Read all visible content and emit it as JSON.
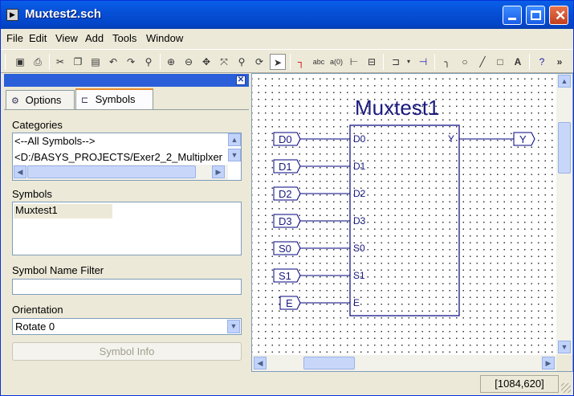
{
  "window": {
    "title": "Muxtest2.sch",
    "app_icon": "schematic-app-icon",
    "controls": [
      "minimize",
      "maximize",
      "close"
    ]
  },
  "menubar": {
    "items": [
      "File",
      "Edit",
      "View",
      "Add",
      "Tools",
      "Window"
    ]
  },
  "toolbar": {
    "icons": [
      "save-icon",
      "print-icon",
      "cut-icon",
      "copy-icon",
      "paste-icon",
      "undo-icon",
      "redo-icon",
      "find-icon",
      "zoom-in-icon",
      "zoom-out-icon",
      "zoom-full-icon",
      "zoom-selection-icon",
      "zoom-area-icon",
      "refresh-icon",
      "select-arrow-icon",
      "add-wire-icon",
      "add-net-name-icon",
      "rename-bus-icon",
      "add-bus-tap-icon",
      "add-io-marker-icon",
      "add-symbol-icon",
      "add-instance-name-icon",
      "add-arc-icon",
      "add-circle-icon",
      "add-line-icon",
      "add-rectangle-icon",
      "add-text-icon",
      "help-icon",
      "more-icon"
    ]
  },
  "panel": {
    "tabs": [
      {
        "label": "Options",
        "icon": "options-icon",
        "selected": false
      },
      {
        "label": "Symbols",
        "icon": "symbols-icon",
        "selected": true
      }
    ],
    "categories_label": "Categories",
    "categories": [
      "<--All Symbols-->",
      "<D:/BASYS_PROJECTS/Exer2_2_Multiplxer"
    ],
    "symbols_label": "Symbols",
    "symbols": [
      "Muxtest1"
    ],
    "filter_label": "Symbol Name Filter",
    "filter_value": "",
    "orientation_label": "Orientation",
    "orientation_value": "Rotate 0",
    "symbol_info_button": "Symbol Info"
  },
  "schematic": {
    "symbol_name": "Muxtest1",
    "inputs": [
      "D0",
      "D1",
      "D2",
      "D3",
      "S0",
      "S1",
      "E"
    ],
    "outputs": [
      "Y"
    ],
    "output_marker": "Y",
    "input_markers": [
      "D0",
      "D1",
      "D2",
      "D3",
      "S0",
      "S1",
      "E"
    ],
    "colors": {
      "text": "#1a1a80",
      "line": "#000080"
    }
  },
  "status": {
    "coordinates": "[1084,620]"
  }
}
